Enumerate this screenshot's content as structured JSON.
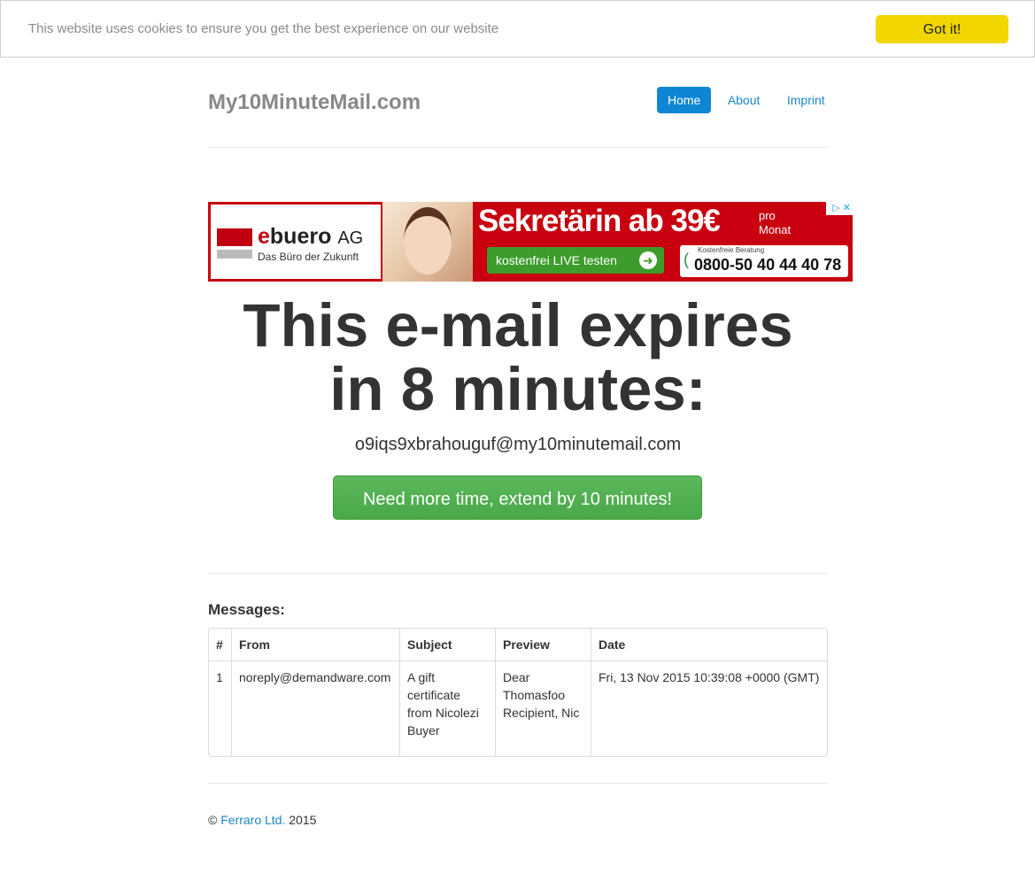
{
  "cookie_bar": {
    "message": "This website uses cookies to ensure you get the best experience on our website",
    "button_label": "Got it!"
  },
  "header": {
    "brand": "My10MinuteMail.com",
    "nav": [
      "Home",
      "About",
      "Imprint"
    ],
    "active_nav": "Home"
  },
  "ad": {
    "brand_prefix": "e",
    "brand_rest": "buero",
    "brand_suffix": "AG",
    "tagline": "Das Büro der Zukunft",
    "headline": "Sekretärin ab 39€",
    "headline_suffix_1": "pro",
    "headline_suffix_2": "Monat",
    "cta": "kostenfrei LIVE testen",
    "phone_label": "Kostenfreie Beratung",
    "phone": "0800-50 40 44 40 78",
    "close_label": "▷ ✕"
  },
  "hero": {
    "title_line_1": "This e-mail expires",
    "title_line_2": "in 8 minutes:",
    "email": "o9iqs9xbrahouguf@my10minutemail.com",
    "extend_button": "Need more time, extend by 10 minutes!"
  },
  "messages": {
    "title": "Messages:",
    "columns": [
      "#",
      "From",
      "Subject",
      "Preview",
      "Date"
    ],
    "rows": [
      {
        "index": "1",
        "from": "noreply@demandware.com",
        "subject": "A gift certificate from Nicolezi Buyer",
        "preview": "Dear Thomasfoo Recipient, Nic",
        "date": "Fri, 13 Nov 2015 10:39:08 +0000 (GMT)"
      }
    ]
  },
  "footer": {
    "copyright_symbol": "©",
    "company": "Ferraro Ltd.",
    "year": "2015"
  },
  "colors": {
    "nav_active": "#0f86d4",
    "link": "#1b87c9",
    "cookie_button": "#f1d600",
    "extend_button": "#5cb85c",
    "ad_background": "#c8000f"
  }
}
